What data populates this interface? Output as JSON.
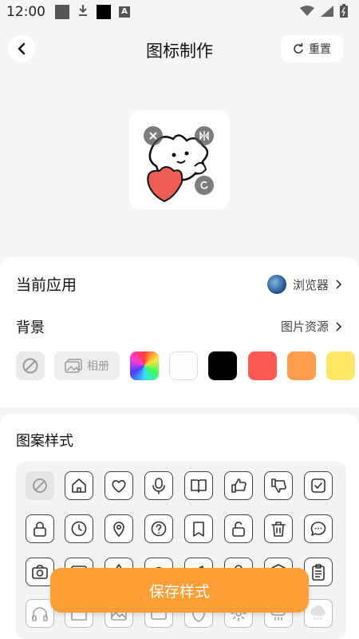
{
  "status_bar": {
    "time": "12:00",
    "a_badge": "A"
  },
  "header": {
    "title": "图标制作",
    "reset_label": "重置"
  },
  "current_app": {
    "label": "当前应用",
    "app_name": "浏览器"
  },
  "background": {
    "label": "背景",
    "link": "图片资源",
    "album_label": "相册",
    "colors": [
      "#fefefe",
      "#000000",
      "#fd5a55",
      "#fe9d4d",
      "#fee766"
    ]
  },
  "pattern": {
    "label": "图案样式",
    "rows": [
      [
        "none-icon",
        "home-icon",
        "heart-icon",
        "mic-icon",
        "book-icon",
        "thumbs-up-icon",
        "thumbs-down-icon",
        "checkbox-icon"
      ],
      [
        "lock-icon",
        "clock-icon",
        "location-pin-icon",
        "question-icon",
        "bookmark-icon",
        "unlock-icon",
        "trash-icon",
        "chat-bubble-icon"
      ],
      [
        "camera-icon",
        "image-icon",
        "drop-icon",
        "cloud-icon",
        "megaphone-icon",
        "user-icon",
        "box-icon",
        "clipboard-icon"
      ],
      [
        "headphones-icon",
        "folder-icon",
        "picture-icon",
        "card-icon",
        "shield-icon",
        "settings-icon",
        "rain-cloud-icon",
        "cloud-rain-icon"
      ]
    ]
  },
  "save_label": "保存样式"
}
